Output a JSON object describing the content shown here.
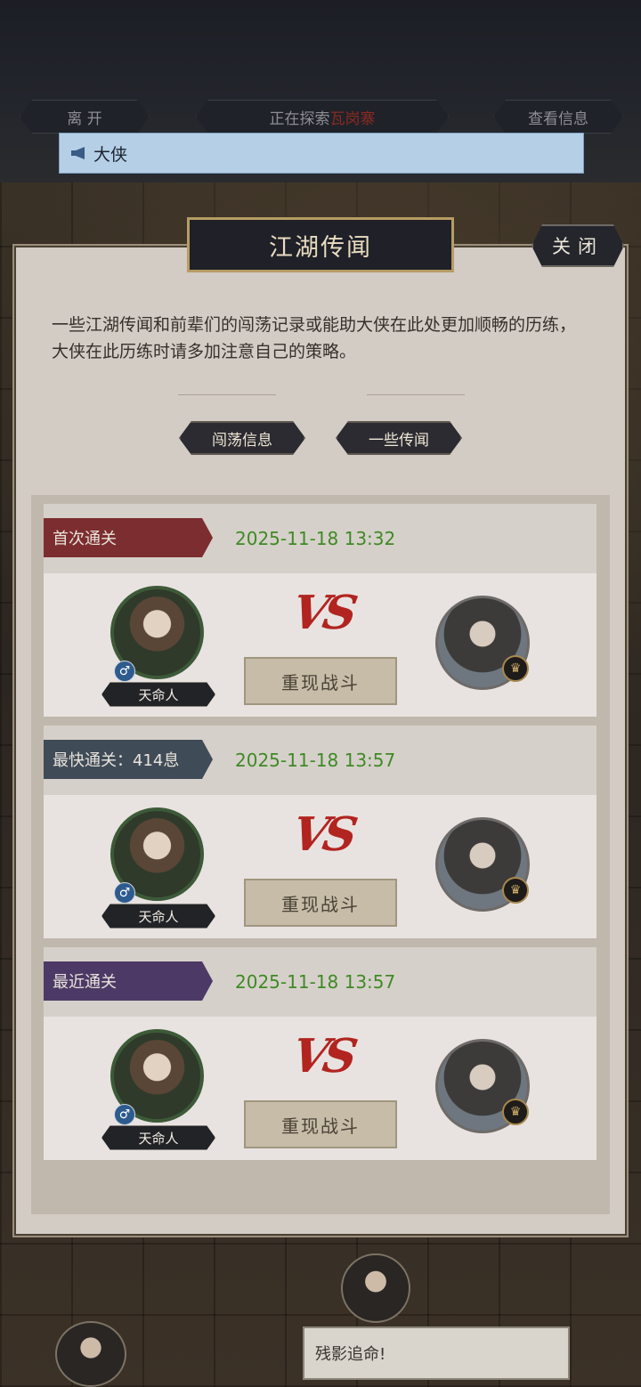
{
  "topbar": {
    "leave_label": "离 开",
    "exploring_prefix": "正在探索",
    "exploring_location": "瓦岗寨",
    "view_info_label": "查看信息"
  },
  "notice": {
    "text": "大侠"
  },
  "panel": {
    "title": "江湖传闻",
    "close_label": "关闭",
    "description": "一些江湖传闻和前辈们的闯荡记录或能助大侠在此处更加顺畅的历练，大侠在此历练时请多加注意自己的策略。",
    "tabs": [
      {
        "label": "闯荡信息"
      },
      {
        "label": "一些传闻"
      }
    ]
  },
  "records": [
    {
      "label": "首次通关",
      "color": "#7c2d2f",
      "date": "2025-11-18 13:32",
      "player_name": "天命人",
      "gender_symbol": "♂",
      "vs": "VS",
      "replay_label": "重现战斗"
    },
    {
      "label": "最快通关：414息",
      "color": "#3f4b57",
      "date": "2025-11-18 13:57",
      "player_name": "天命人",
      "gender_symbol": "♂",
      "vs": "VS",
      "replay_label": "重现战斗"
    },
    {
      "label": "最近通关",
      "color": "#4d3966",
      "date": "2025-11-18 13:57",
      "player_name": "天命人",
      "gender_symbol": "♂",
      "vs": "VS",
      "replay_label": "重现战斗"
    }
  ],
  "bottom": {
    "chat_text": "残影追命!"
  }
}
